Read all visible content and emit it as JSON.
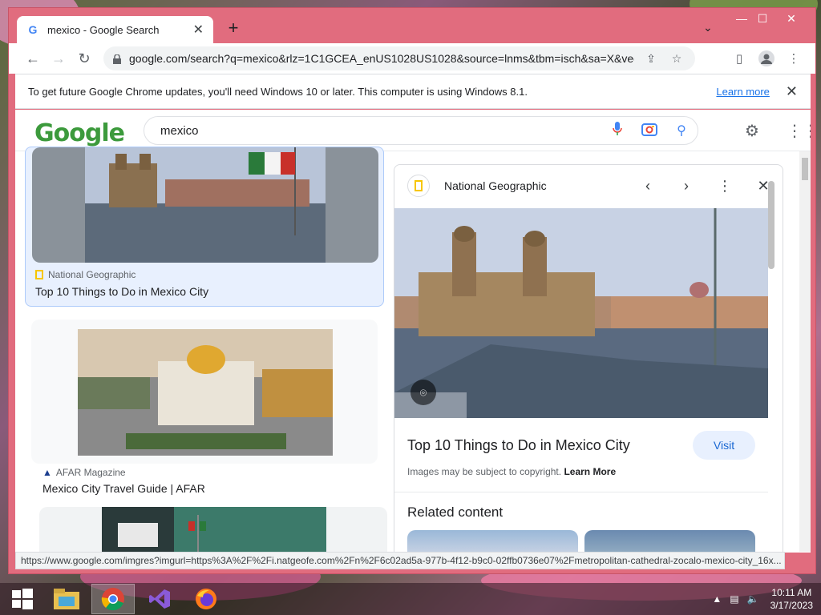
{
  "browser": {
    "tab_title": "mexico - Google Search",
    "new_tab_symbol": "+",
    "url": "google.com/search?q=mexico&rlz=1C1GCEA_enUS1028US1028&source=lnms&tbm=isch&sa=X&ved=2a...",
    "infobar": {
      "message": "To get future Google Chrome updates, you'll need Windows 10 or later. This computer is using Windows 8.1.",
      "link": "Learn more"
    },
    "status_url": "https://www.google.com/imgres?imgurl=https%3A%2F%2Fi.natgeofe.com%2Fn%2F6c02ad5a-977b-4f12-b9c0-02ffb0736e07%2Fmetropolitan-cathedral-zocalo-mexico-city_16x..."
  },
  "google": {
    "logo_text": "Google",
    "query": "mexico"
  },
  "results": [
    {
      "source": "National Geographic",
      "title": "Top 10 Things to Do in Mexico City"
    },
    {
      "source": "AFAR Magazine",
      "title": "Mexico City Travel Guide | AFAR"
    }
  ],
  "panel": {
    "source": "National Geographic",
    "title": "Top 10 Things to Do in Mexico City",
    "visit": "Visit",
    "copyright": "Images may be subject to copyright.",
    "copyright_link": "Learn More",
    "related": "Related content"
  },
  "taskbar": {
    "time": "10:11 AM",
    "date": "3/17/2023"
  },
  "colors": {
    "window_frame": "#e16c7e",
    "link_blue": "#1a73e8",
    "visit_bg": "#e8f0fe"
  }
}
